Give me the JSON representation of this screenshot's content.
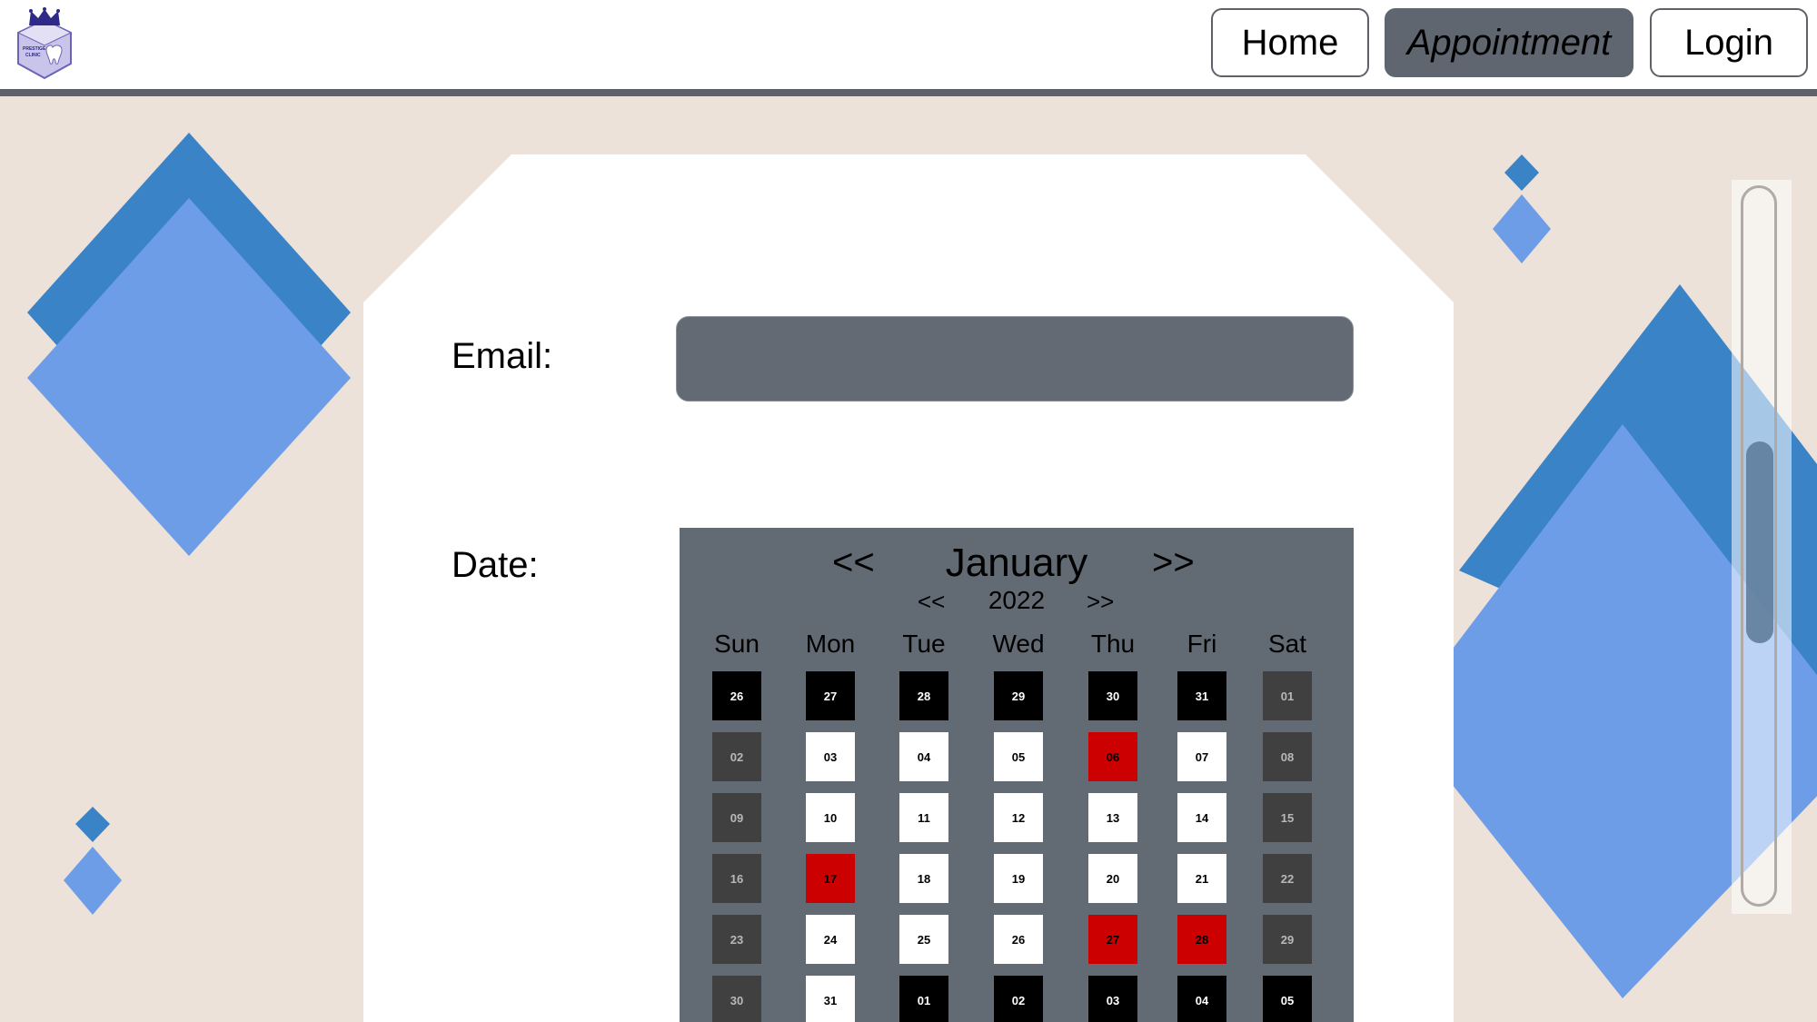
{
  "header": {
    "logo_text": [
      "PRESTIGE",
      "CLINIC"
    ],
    "nav": [
      {
        "label": "Home",
        "active": false
      },
      {
        "label": "Appointment",
        "active": true
      },
      {
        "label": "Login",
        "active": false
      }
    ]
  },
  "form": {
    "email_label": "Email:",
    "email_value": "",
    "date_label": "Date:"
  },
  "calendar": {
    "prev_month": "<<",
    "month": "January",
    "next_month": ">>",
    "prev_year": "<<",
    "year": "2022",
    "next_year": ">>",
    "weekdays": [
      "Sun",
      "Mon",
      "Tue",
      "Wed",
      "Thu",
      "Fri",
      "Sat"
    ],
    "weeks": [
      [
        {
          "d": "26",
          "s": "other"
        },
        {
          "d": "27",
          "s": "other"
        },
        {
          "d": "28",
          "s": "other"
        },
        {
          "d": "29",
          "s": "other"
        },
        {
          "d": "30",
          "s": "other"
        },
        {
          "d": "31",
          "s": "other"
        },
        {
          "d": "01",
          "s": "weekend"
        }
      ],
      [
        {
          "d": "02",
          "s": "weekend"
        },
        {
          "d": "03",
          "s": "avail"
        },
        {
          "d": "04",
          "s": "avail"
        },
        {
          "d": "05",
          "s": "avail"
        },
        {
          "d": "06",
          "s": "booked"
        },
        {
          "d": "07",
          "s": "avail"
        },
        {
          "d": "08",
          "s": "weekend"
        }
      ],
      [
        {
          "d": "09",
          "s": "weekend"
        },
        {
          "d": "10",
          "s": "avail"
        },
        {
          "d": "11",
          "s": "avail"
        },
        {
          "d": "12",
          "s": "avail"
        },
        {
          "d": "13",
          "s": "avail"
        },
        {
          "d": "14",
          "s": "avail"
        },
        {
          "d": "15",
          "s": "weekend"
        }
      ],
      [
        {
          "d": "16",
          "s": "weekend"
        },
        {
          "d": "17",
          "s": "booked"
        },
        {
          "d": "18",
          "s": "avail"
        },
        {
          "d": "19",
          "s": "avail"
        },
        {
          "d": "20",
          "s": "avail"
        },
        {
          "d": "21",
          "s": "avail"
        },
        {
          "d": "22",
          "s": "weekend"
        }
      ],
      [
        {
          "d": "23",
          "s": "weekend"
        },
        {
          "d": "24",
          "s": "avail"
        },
        {
          "d": "25",
          "s": "avail"
        },
        {
          "d": "26",
          "s": "avail"
        },
        {
          "d": "27",
          "s": "booked"
        },
        {
          "d": "28",
          "s": "booked"
        },
        {
          "d": "29",
          "s": "weekend"
        }
      ],
      [
        {
          "d": "30",
          "s": "weekend"
        },
        {
          "d": "31",
          "s": "avail"
        },
        {
          "d": "01",
          "s": "other"
        },
        {
          "d": "02",
          "s": "other"
        },
        {
          "d": "03",
          "s": "other"
        },
        {
          "d": "04",
          "s": "other"
        },
        {
          "d": "05",
          "s": "other"
        }
      ]
    ]
  },
  "colors": {
    "header_rule": "#5d6168",
    "page_bg": "#ece2da",
    "nav_active": "#5f6670",
    "input_bg": "#636a73",
    "calendar_bg": "#626a73",
    "booked": "#cc0000",
    "diamond_dark": "#3b83c7",
    "diamond_light": "#6e9de8"
  }
}
